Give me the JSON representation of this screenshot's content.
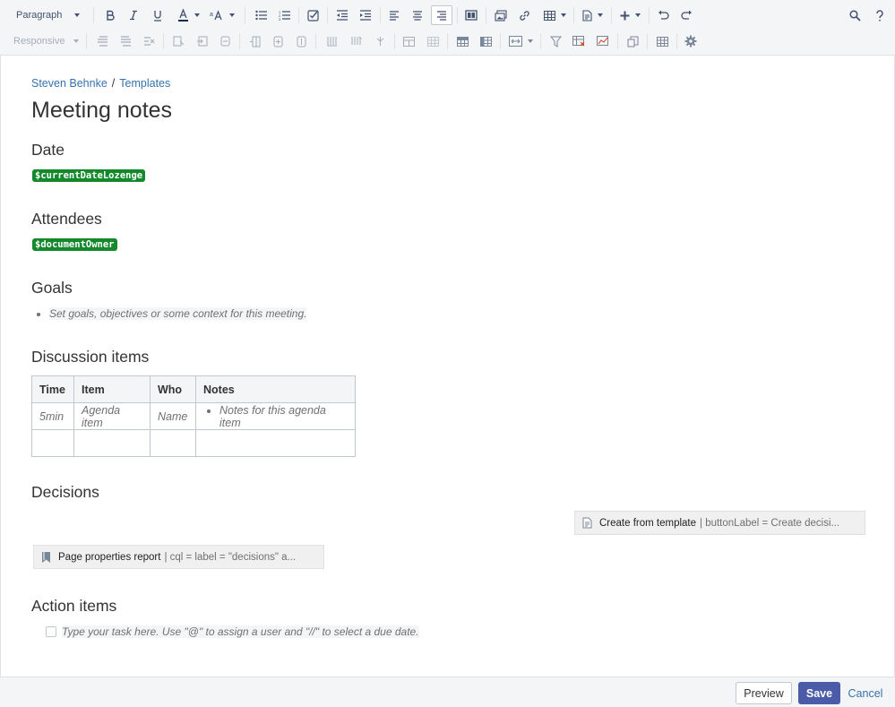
{
  "toolbar": {
    "paragraph_label": "Paragraph",
    "responsive_label": "Responsive"
  },
  "breadcrumb": {
    "items": [
      "Steven Behnke",
      "Templates"
    ],
    "separator": "/"
  },
  "page": {
    "title": "Meeting notes",
    "sections": {
      "date": "Date",
      "attendees": "Attendees",
      "goals": "Goals",
      "discussion": "Discussion items",
      "decisions": "Decisions",
      "actions": "Action items"
    },
    "date_lozenge": "$currentDateLozenge",
    "attendees_lozenge": "$documentOwner",
    "goals_placeholder": "Set goals, objectives or some context for this meeting.",
    "table": {
      "headers": [
        "Time",
        "Item",
        "Who",
        "Notes"
      ],
      "rows": [
        [
          "5min",
          "Agenda item",
          "Name",
          "Notes for this agenda item"
        ],
        [
          "",
          "",
          "",
          ""
        ]
      ]
    },
    "create_from_template": {
      "name": "Create from template",
      "params": "| buttonLabel = Create decisi..."
    },
    "page_properties_report": {
      "name": "Page properties report",
      "params": "| cql = label = \"decisions\" a..."
    },
    "task_placeholder": "Type your task here. Use \"@\" to assign a user and \"//\" to select a due date."
  },
  "footer": {
    "preview_label": "Preview",
    "save_label": "Save",
    "cancel_label": "Cancel"
  },
  "colors": {
    "lozenge": "#14892c",
    "link": "#3572b0",
    "save": "#4b5ba8"
  }
}
